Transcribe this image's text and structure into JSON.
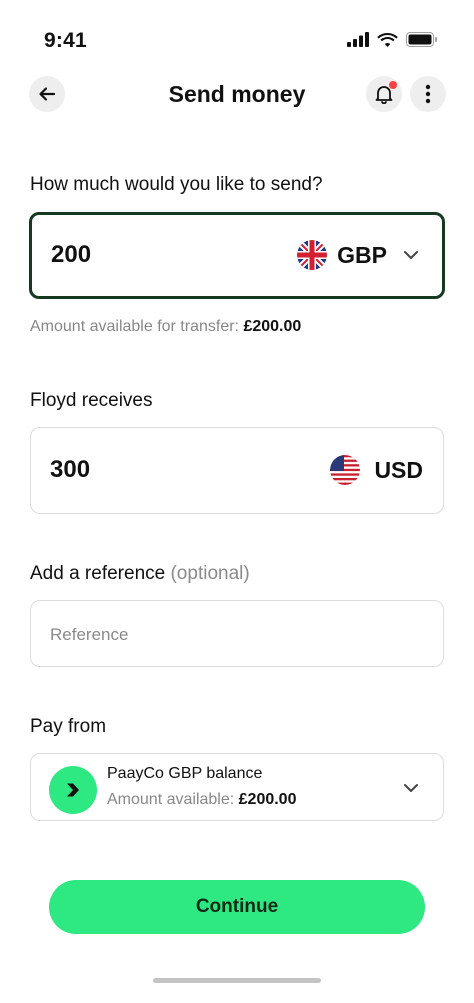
{
  "status_bar": {
    "time": "9:41"
  },
  "header": {
    "title": "Send money"
  },
  "send": {
    "label": "How much would you like to send?",
    "amount": "200",
    "currency": "GBP",
    "helper_prefix": "Amount available for transfer:",
    "helper_amount": "£200.00"
  },
  "receive": {
    "label": "Floyd receives",
    "amount": "300",
    "currency": "USD"
  },
  "reference": {
    "label": "Add a reference",
    "label_suffix": "(optional)",
    "placeholder": "Reference"
  },
  "pay_from": {
    "label": "Pay from",
    "title": "PaayCo GBP balance",
    "sub_prefix": "Amount available:",
    "sub_amount": "£200.00"
  },
  "actions": {
    "continue_label": "Continue"
  },
  "colors": {
    "accent": "#2ee882",
    "active_border": "#163a1f",
    "notification_dot": "#ff4040"
  },
  "icons": [
    "back-arrow-icon",
    "bell-icon",
    "more-vertical-icon",
    "uk-flag-icon",
    "us-flag-icon",
    "chevron-down-icon",
    "brand-arrow-icon"
  ]
}
